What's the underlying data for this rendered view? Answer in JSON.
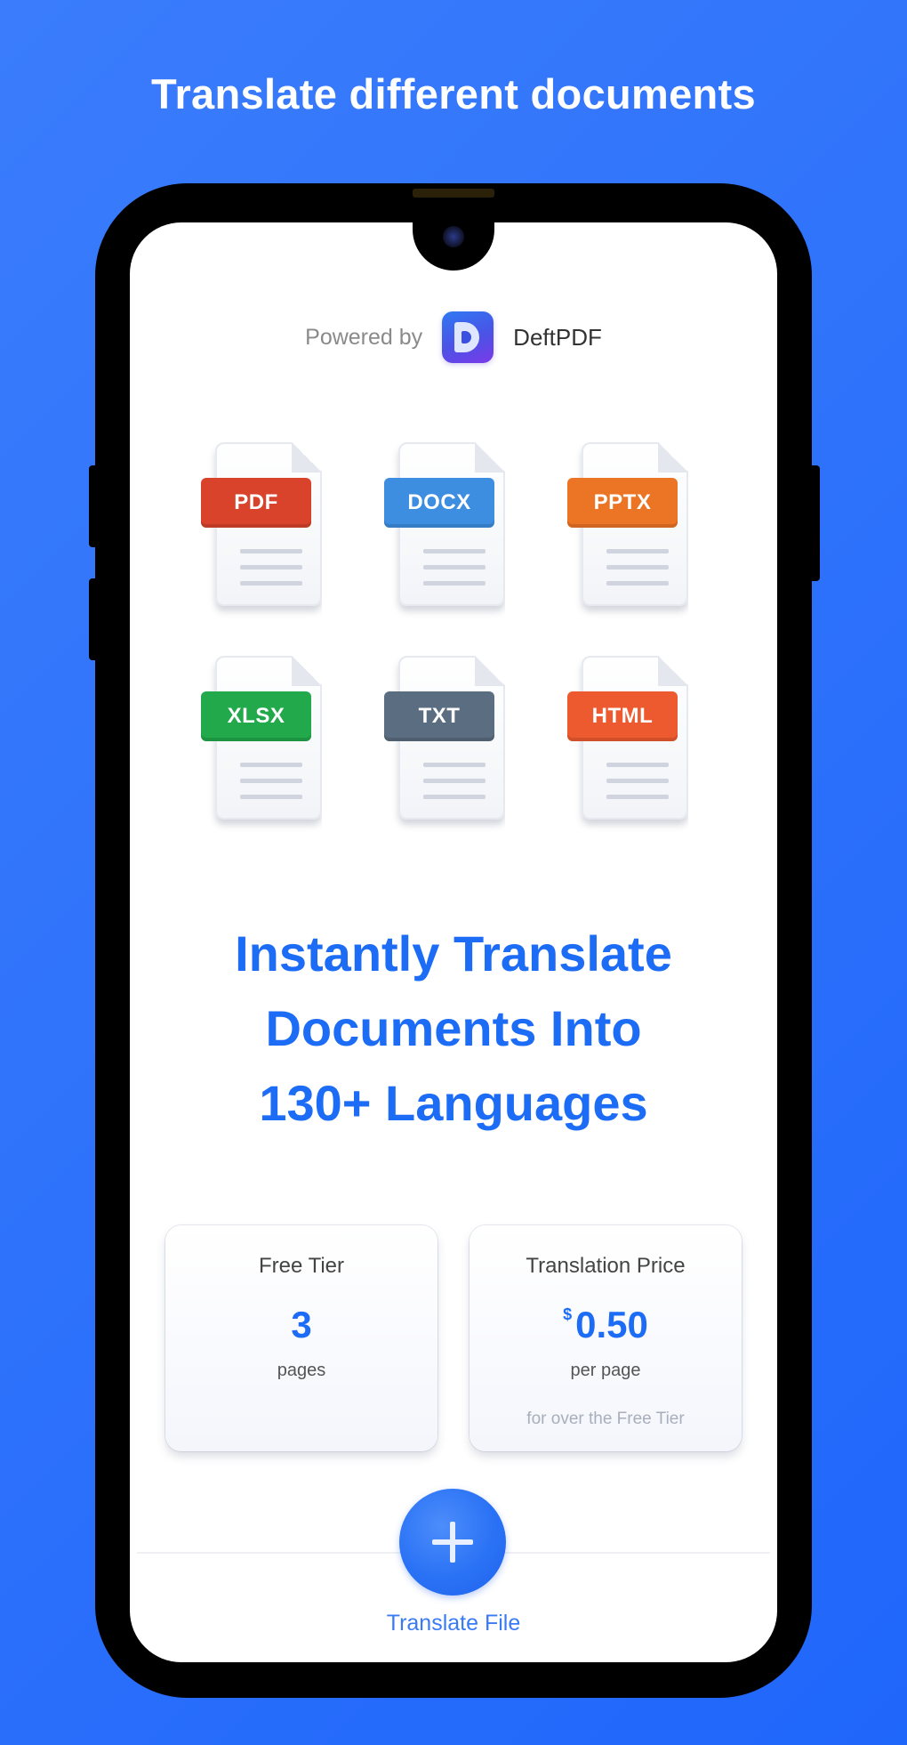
{
  "banner": {
    "title": "Translate different documents"
  },
  "header": {
    "powered_by_label": "Powered by",
    "brand_name": "DeftPDF",
    "brand_logo_icon": "deftpdf-logo-icon"
  },
  "file_types": [
    {
      "label": "PDF",
      "color": "#d9432c",
      "icon": "pdf-file-icon"
    },
    {
      "label": "DOCX",
      "color": "#3d8ee0",
      "icon": "docx-file-icon"
    },
    {
      "label": "PPTX",
      "color": "#ec7425",
      "icon": "pptx-file-icon"
    },
    {
      "label": "XLSX",
      "color": "#22a94b",
      "icon": "xlsx-file-icon"
    },
    {
      "label": "TXT",
      "color": "#5b6d80",
      "icon": "txt-file-icon"
    },
    {
      "label": "HTML",
      "color": "#ee5a2f",
      "icon": "html-file-icon"
    }
  ],
  "headline": {
    "lines": [
      "Instantly Translate",
      "Documents Into",
      "130+ Languages"
    ]
  },
  "pricing": {
    "free_tier": {
      "title": "Free Tier",
      "value": "3",
      "unit": "pages"
    },
    "translation_price": {
      "title": "Translation Price",
      "currency": "$",
      "value": "0.50",
      "unit": "per page",
      "note": "for over the Free Tier"
    }
  },
  "action": {
    "label": "Translate File",
    "icon": "plus-icon"
  },
  "colors": {
    "background": "#2f73fb",
    "accent": "#1d6cf5",
    "phone_frame": "#000000"
  }
}
